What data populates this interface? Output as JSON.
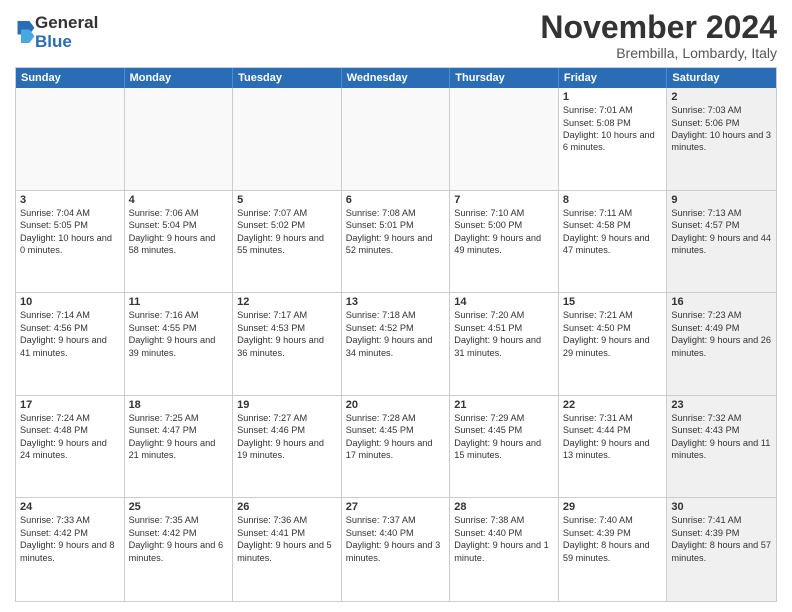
{
  "logo": {
    "general": "General",
    "blue": "Blue"
  },
  "title": "November 2024",
  "location": "Brembilla, Lombardy, Italy",
  "days": [
    "Sunday",
    "Monday",
    "Tuesday",
    "Wednesday",
    "Thursday",
    "Friday",
    "Saturday"
  ],
  "rows": [
    [
      {
        "day": "",
        "info": "",
        "empty": true
      },
      {
        "day": "",
        "info": "",
        "empty": true
      },
      {
        "day": "",
        "info": "",
        "empty": true
      },
      {
        "day": "",
        "info": "",
        "empty": true
      },
      {
        "day": "",
        "info": "",
        "empty": true
      },
      {
        "day": "1",
        "info": "Sunrise: 7:01 AM\nSunset: 5:08 PM\nDaylight: 10 hours and 6 minutes.",
        "empty": false
      },
      {
        "day": "2",
        "info": "Sunrise: 7:03 AM\nSunset: 5:06 PM\nDaylight: 10 hours and 3 minutes.",
        "empty": false,
        "shaded": true
      }
    ],
    [
      {
        "day": "3",
        "info": "Sunrise: 7:04 AM\nSunset: 5:05 PM\nDaylight: 10 hours and 0 minutes.",
        "empty": false
      },
      {
        "day": "4",
        "info": "Sunrise: 7:06 AM\nSunset: 5:04 PM\nDaylight: 9 hours and 58 minutes.",
        "empty": false
      },
      {
        "day": "5",
        "info": "Sunrise: 7:07 AM\nSunset: 5:02 PM\nDaylight: 9 hours and 55 minutes.",
        "empty": false
      },
      {
        "day": "6",
        "info": "Sunrise: 7:08 AM\nSunset: 5:01 PM\nDaylight: 9 hours and 52 minutes.",
        "empty": false
      },
      {
        "day": "7",
        "info": "Sunrise: 7:10 AM\nSunset: 5:00 PM\nDaylight: 9 hours and 49 minutes.",
        "empty": false
      },
      {
        "day": "8",
        "info": "Sunrise: 7:11 AM\nSunset: 4:58 PM\nDaylight: 9 hours and 47 minutes.",
        "empty": false
      },
      {
        "day": "9",
        "info": "Sunrise: 7:13 AM\nSunset: 4:57 PM\nDaylight: 9 hours and 44 minutes.",
        "empty": false,
        "shaded": true
      }
    ],
    [
      {
        "day": "10",
        "info": "Sunrise: 7:14 AM\nSunset: 4:56 PM\nDaylight: 9 hours and 41 minutes.",
        "empty": false
      },
      {
        "day": "11",
        "info": "Sunrise: 7:16 AM\nSunset: 4:55 PM\nDaylight: 9 hours and 39 minutes.",
        "empty": false
      },
      {
        "day": "12",
        "info": "Sunrise: 7:17 AM\nSunset: 4:53 PM\nDaylight: 9 hours and 36 minutes.",
        "empty": false
      },
      {
        "day": "13",
        "info": "Sunrise: 7:18 AM\nSunset: 4:52 PM\nDaylight: 9 hours and 34 minutes.",
        "empty": false
      },
      {
        "day": "14",
        "info": "Sunrise: 7:20 AM\nSunset: 4:51 PM\nDaylight: 9 hours and 31 minutes.",
        "empty": false
      },
      {
        "day": "15",
        "info": "Sunrise: 7:21 AM\nSunset: 4:50 PM\nDaylight: 9 hours and 29 minutes.",
        "empty": false
      },
      {
        "day": "16",
        "info": "Sunrise: 7:23 AM\nSunset: 4:49 PM\nDaylight: 9 hours and 26 minutes.",
        "empty": false,
        "shaded": true
      }
    ],
    [
      {
        "day": "17",
        "info": "Sunrise: 7:24 AM\nSunset: 4:48 PM\nDaylight: 9 hours and 24 minutes.",
        "empty": false
      },
      {
        "day": "18",
        "info": "Sunrise: 7:25 AM\nSunset: 4:47 PM\nDaylight: 9 hours and 21 minutes.",
        "empty": false
      },
      {
        "day": "19",
        "info": "Sunrise: 7:27 AM\nSunset: 4:46 PM\nDaylight: 9 hours and 19 minutes.",
        "empty": false
      },
      {
        "day": "20",
        "info": "Sunrise: 7:28 AM\nSunset: 4:45 PM\nDaylight: 9 hours and 17 minutes.",
        "empty": false
      },
      {
        "day": "21",
        "info": "Sunrise: 7:29 AM\nSunset: 4:45 PM\nDaylight: 9 hours and 15 minutes.",
        "empty": false
      },
      {
        "day": "22",
        "info": "Sunrise: 7:31 AM\nSunset: 4:44 PM\nDaylight: 9 hours and 13 minutes.",
        "empty": false
      },
      {
        "day": "23",
        "info": "Sunrise: 7:32 AM\nSunset: 4:43 PM\nDaylight: 9 hours and 11 minutes.",
        "empty": false,
        "shaded": true
      }
    ],
    [
      {
        "day": "24",
        "info": "Sunrise: 7:33 AM\nSunset: 4:42 PM\nDaylight: 9 hours and 8 minutes.",
        "empty": false
      },
      {
        "day": "25",
        "info": "Sunrise: 7:35 AM\nSunset: 4:42 PM\nDaylight: 9 hours and 6 minutes.",
        "empty": false
      },
      {
        "day": "26",
        "info": "Sunrise: 7:36 AM\nSunset: 4:41 PM\nDaylight: 9 hours and 5 minutes.",
        "empty": false
      },
      {
        "day": "27",
        "info": "Sunrise: 7:37 AM\nSunset: 4:40 PM\nDaylight: 9 hours and 3 minutes.",
        "empty": false
      },
      {
        "day": "28",
        "info": "Sunrise: 7:38 AM\nSunset: 4:40 PM\nDaylight: 9 hours and 1 minute.",
        "empty": false
      },
      {
        "day": "29",
        "info": "Sunrise: 7:40 AM\nSunset: 4:39 PM\nDaylight: 8 hours and 59 minutes.",
        "empty": false
      },
      {
        "day": "30",
        "info": "Sunrise: 7:41 AM\nSunset: 4:39 PM\nDaylight: 8 hours and 57 minutes.",
        "empty": false,
        "shaded": true
      }
    ]
  ]
}
